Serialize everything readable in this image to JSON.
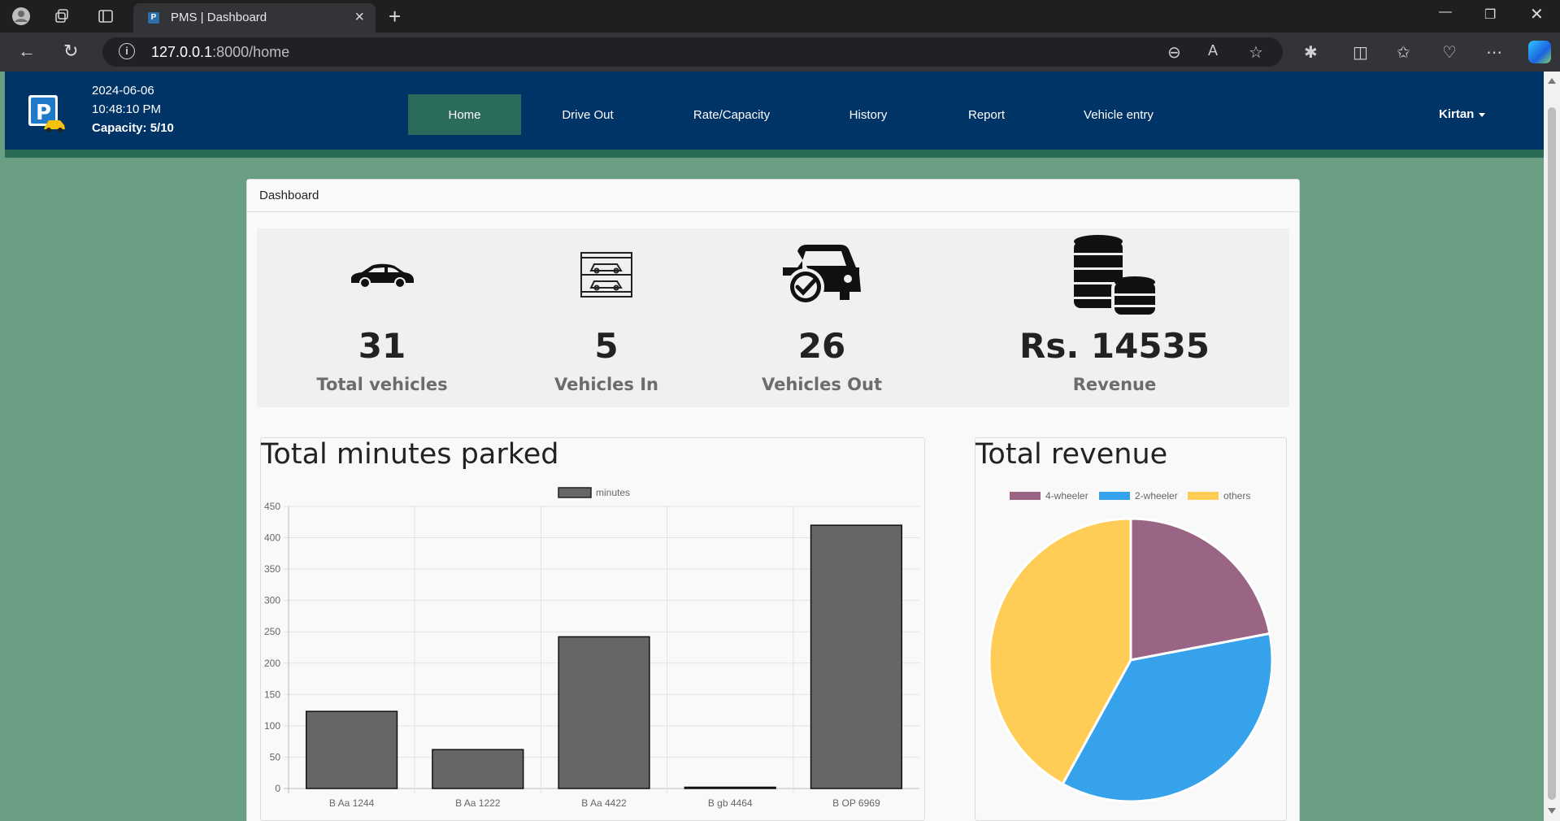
{
  "browser": {
    "tab_title": "PMS | Dashboard",
    "url_host": "127.0.0.1",
    "url_rest": ":8000/home",
    "favicon_letter": "P"
  },
  "header": {
    "date": "2024-06-06",
    "time": "10:48:10 PM",
    "capacity": "Capacity: 5/10",
    "user": "Kirtan",
    "logo_letter": "P"
  },
  "nav": {
    "items": [
      {
        "label": "Home",
        "active": true
      },
      {
        "label": "Drive Out",
        "active": false
      },
      {
        "label": "Rate/Capacity",
        "active": false
      },
      {
        "label": "History",
        "active": false
      },
      {
        "label": "Report",
        "active": false
      },
      {
        "label": "Vehicle entry",
        "active": false
      }
    ]
  },
  "card": {
    "title": "Dashboard"
  },
  "stats": [
    {
      "value": "31",
      "label": "Total vehicles",
      "icon": "car-icon"
    },
    {
      "value": "5",
      "label": "Vehicles In",
      "icon": "parking-garage-icon"
    },
    {
      "value": "26",
      "label": "Vehicles Out",
      "icon": "car-check-icon"
    },
    {
      "value": "Rs. 14535",
      "label": "Revenue",
      "icon": "coins-icon"
    }
  ],
  "colors": {
    "navbar": "#003366",
    "active_nav": "#2a6b5b",
    "background": "#6a9e82",
    "bar_fill": "#666666",
    "pie_4wheeler": "#9a6484",
    "pie_2wheeler": "#36a2eb",
    "pie_others": "#ffcd56"
  },
  "chart_data": [
    {
      "type": "bar",
      "title": "Total minutes parked",
      "legend": [
        "minutes"
      ],
      "categories": [
        "B Aa 1244",
        "B Aa 1222",
        "B Aa 4422",
        "B gb 4464",
        "B OP 6969"
      ],
      "series": [
        {
          "name": "minutes",
          "values": [
            123,
            62,
            242,
            2,
            420
          ]
        }
      ],
      "ylim": [
        0,
        450
      ],
      "yticks": [
        450,
        400,
        350,
        300,
        250,
        200,
        150,
        100,
        50,
        0
      ],
      "grid": true,
      "legend_position": "top"
    },
    {
      "type": "pie",
      "title": "Total revenue",
      "labels": [
        "4-wheeler",
        "2-wheeler",
        "others"
      ],
      "values": [
        22,
        36,
        42
      ],
      "legend_position": "top"
    }
  ]
}
